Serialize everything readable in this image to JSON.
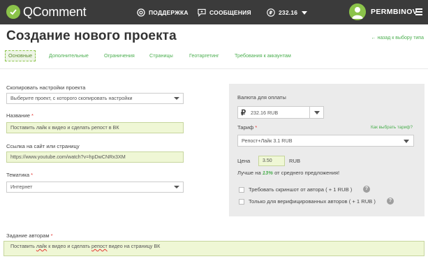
{
  "header": {
    "logo_text": "QComment",
    "nav": [
      {
        "label": "ПОДДЕРЖКА",
        "icon": "support-icon"
      },
      {
        "label": "СООБЩЕНИЯ",
        "icon": "message-icon"
      }
    ],
    "balance": "232.16",
    "balance_icon": "ruble-icon",
    "username": "PERMBINOV"
  },
  "page": {
    "title": "Создание нового проекта",
    "back_link": "← назад к выбору типа"
  },
  "tabs": [
    {
      "label": "Основные",
      "active": true
    },
    {
      "label": "Дополнительные"
    },
    {
      "label": "Ограничения"
    },
    {
      "label": "Страницы"
    },
    {
      "label": "Геотаргетинг"
    },
    {
      "label": "Требования к аккаунтам"
    }
  ],
  "form": {
    "copy_settings": {
      "label": "Скопировать настройки проекта",
      "value": "Выберите проект, с которого скопировать настройки"
    },
    "name": {
      "label": "Название",
      "required_mark": "*",
      "value": "Поставить лайк к видео и сделать репост в ВК"
    },
    "url": {
      "label": "Ссылка на сайт или страницу",
      "value": "https://www.youtube.com/watch?v=hpDwCNRx3XM"
    },
    "topic": {
      "label": "Тематика",
      "required_mark": "*",
      "value": "Интернет"
    },
    "task": {
      "label": "Задание авторам",
      "required_mark": "*",
      "value_parts": [
        "Поставить ",
        "лайк",
        " к видео и сделать ",
        "репост",
        " видео на страницу ВК"
      ]
    }
  },
  "payment": {
    "currency_label": "Валюта для оплаты",
    "currency_symbol": "₽",
    "currency_value": "232.16 RUB",
    "tariff_label": "Тариф",
    "tariff_required": "*",
    "choose_tariff_link": "Как выбрать тариф?",
    "tariff_value": "Репост+Лайк 3.1 RUB",
    "price_label": "Цена",
    "price_value": "3.50",
    "price_unit": "RUB",
    "better_prefix": "Лучше на",
    "better_percent": "13%",
    "better_suffix": "от среднего предложения!",
    "option_screenshot": "Требовать скриншот от автора ( + 1 RUB )",
    "option_verified": "Только для верифицированных авторов ( + 1 RUB )",
    "help_mark": "?"
  },
  "colors": {
    "topbar": "#3b3b3b",
    "accent": "#4caf50",
    "input_bg": "#eff7d5",
    "panel_bg": "#ebebeb"
  }
}
